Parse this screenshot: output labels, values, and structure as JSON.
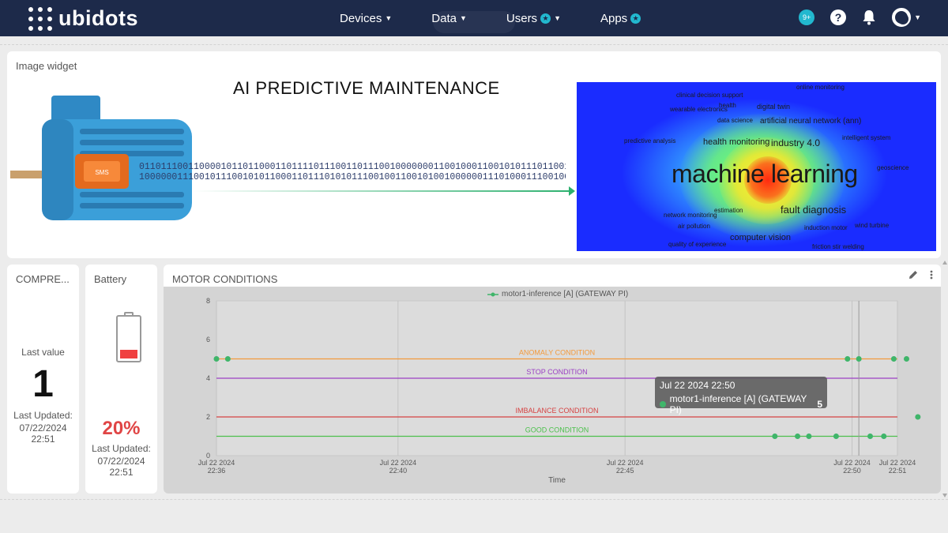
{
  "app": {
    "brand": "ubidots"
  },
  "nav": {
    "items": [
      {
        "label": "Devices",
        "caret": true,
        "star": false
      },
      {
        "label": "Data",
        "caret": true,
        "star": false
      },
      {
        "label": "Users",
        "caret": true,
        "star": true
      },
      {
        "label": "Apps",
        "caret": false,
        "star": true
      }
    ],
    "notifications_badge": "9+",
    "help_glyph": "?"
  },
  "image_widget": {
    "title": "Image widget",
    "headline": "AI PREDICTIVE MAINTENANCE",
    "motor_plate": "SMS",
    "binary_line1": "0110111001100001011011000110111101110011011100100000001100100011001010111011001101001011",
    "binary_line2": "1000000111001011100101011000110111010101110010011001010010000001110100011100100110011",
    "word_cloud": {
      "main": "machine learning",
      "terms": [
        "online monitoring",
        "clinical decision support",
        "health",
        "digital twin",
        "data science",
        "artificial neural network (ann)",
        "predictive analysis",
        "health monitoring",
        "industry 4.0",
        "intelligent system",
        "fault diagnosis",
        "estimation",
        "air pollution",
        "induction motor",
        "wind turbine",
        "computer vision",
        "quality of experience",
        "friction stir welding",
        "geoscience",
        "wearable electronics",
        "network monitoring"
      ]
    }
  },
  "compressor": {
    "title": "COMPRE...",
    "last_value_label": "Last value",
    "value": "1",
    "updated_label": "Last Updated:",
    "updated": "07/22/2024 22:51"
  },
  "battery": {
    "title": "Battery",
    "percent": "20%",
    "level": 0.2,
    "updated_label": "Last Updated:",
    "updated": "07/22/2024 22:51"
  },
  "motor_chart": {
    "title": "MOTOR CONDITIONS",
    "actions": {
      "edit": "pencil-icon",
      "more": "more-vertical-icon"
    },
    "tooltip": {
      "time": "Jul 22 2024 22:50",
      "series": "motor1-inference [A] (GATEWAY PI)",
      "value": "5"
    }
  },
  "chart_data": {
    "type": "scatter",
    "xlabel": "Time",
    "ylabel": "",
    "ylim": [
      0,
      8
    ],
    "yticks": [
      0,
      2,
      4,
      6,
      8
    ],
    "xlim_minutes": [
      0,
      15
    ],
    "xticks": [
      {
        "t": 0,
        "line1": "Jul 22 2024",
        "line2": "22:36"
      },
      {
        "t": 4,
        "line1": "Jul 22 2024",
        "line2": "22:40"
      },
      {
        "t": 9,
        "line1": "Jul 22 2024",
        "line2": "22:45"
      },
      {
        "t": 14,
        "line1": "Jul 22 2024",
        "line2": "22:50"
      },
      {
        "t": 15,
        "line1": "Jul 22 2024",
        "line2": "22:51"
      }
    ],
    "series": [
      {
        "name": "motor1-inference [A] (GATEWAY PI)",
        "color": "#3fb56a",
        "points": [
          {
            "x": 0.0,
            "y": 5
          },
          {
            "x": 0.25,
            "y": 5
          },
          {
            "x": 12.3,
            "y": 1
          },
          {
            "x": 12.8,
            "y": 1
          },
          {
            "x": 13.05,
            "y": 1
          },
          {
            "x": 13.65,
            "y": 1
          },
          {
            "x": 13.9,
            "y": 5
          },
          {
            "x": 14.15,
            "y": 5
          },
          {
            "x": 14.4,
            "y": 1
          },
          {
            "x": 14.7,
            "y": 1
          },
          {
            "x": 14.92,
            "y": 5
          },
          {
            "x": 15.2,
            "y": 5
          },
          {
            "x": 15.45,
            "y": 2
          }
        ]
      }
    ],
    "reference_lines": [
      {
        "label": "ANOMALY CONDITION",
        "y": 5,
        "color": "#f39a3c"
      },
      {
        "label": "STOP CONDITION",
        "y": 4,
        "color": "#9b3fc4"
      },
      {
        "label": "IMBALANCE CONDITION",
        "y": 2,
        "color": "#d64242"
      },
      {
        "label": "GOOD CONDITION",
        "y": 1,
        "color": "#4cc04c"
      }
    ],
    "hover_x": 14.15,
    "grid": true,
    "legend": "top"
  }
}
